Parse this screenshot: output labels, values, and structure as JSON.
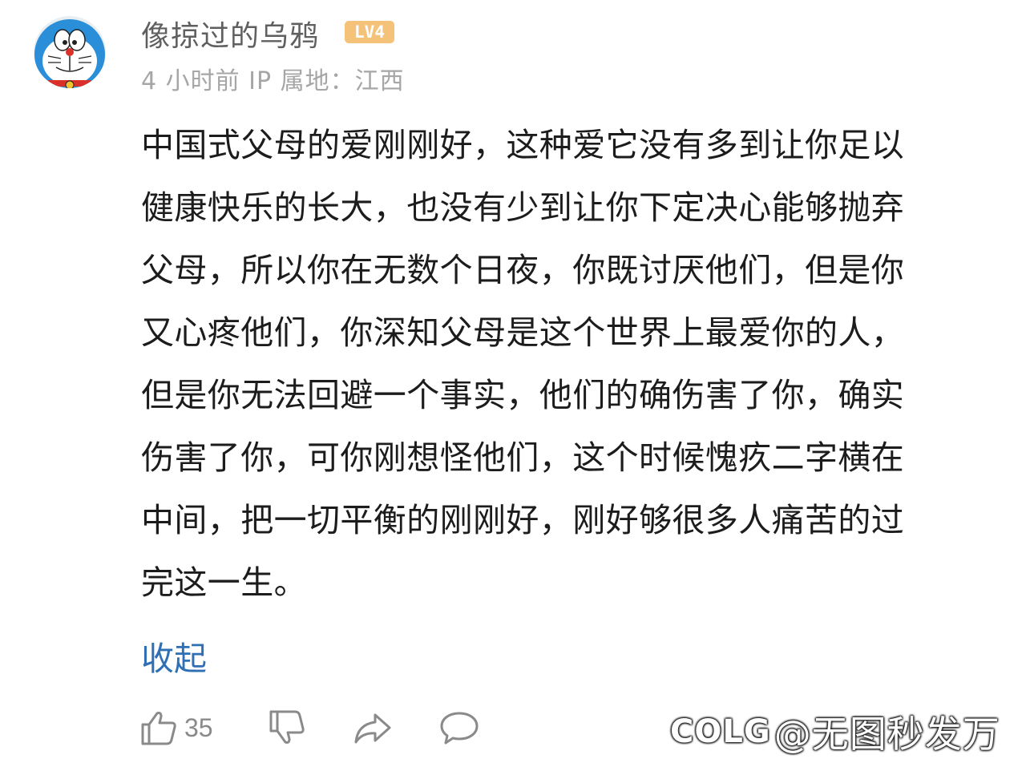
{
  "comment": {
    "username": "像掠过的乌鸦",
    "level": "LV4",
    "time": "4 小时前",
    "ip_location": "IP 属地：江西",
    "body_lines": [
      "中国式父母的爱刚刚好，这种爱它没有多到让你足以",
      "健康快乐的长大，也没有少到让你下定决心能够抛弃",
      "父母，所以你在无数个日夜，你既讨厌他们，但是你",
      "又心疼他们，你深知父母是这个世界上最爱你的人，",
      "但是你无法回避一个事实，他们的确伤害了你，确实",
      "伤害了你，可你刚想怪他们，这个时候愧疚二字横在",
      "中间，把一切平衡的刚刚好，刚好够很多人痛苦的过",
      "完这一生。"
    ],
    "collapse_label": "收起",
    "like_count": "35"
  },
  "icons": {
    "like": "thumbs-up-icon",
    "dislike": "thumbs-down-icon",
    "share": "share-icon",
    "reply": "comment-bubble-icon"
  },
  "watermark": {
    "logo": "COLG",
    "text": "@无图秒发万"
  },
  "colors": {
    "link": "#2f6fb4",
    "badge": "#f5c27a",
    "meta_text": "#a6a6a6",
    "body_text": "#1c1c1c"
  }
}
